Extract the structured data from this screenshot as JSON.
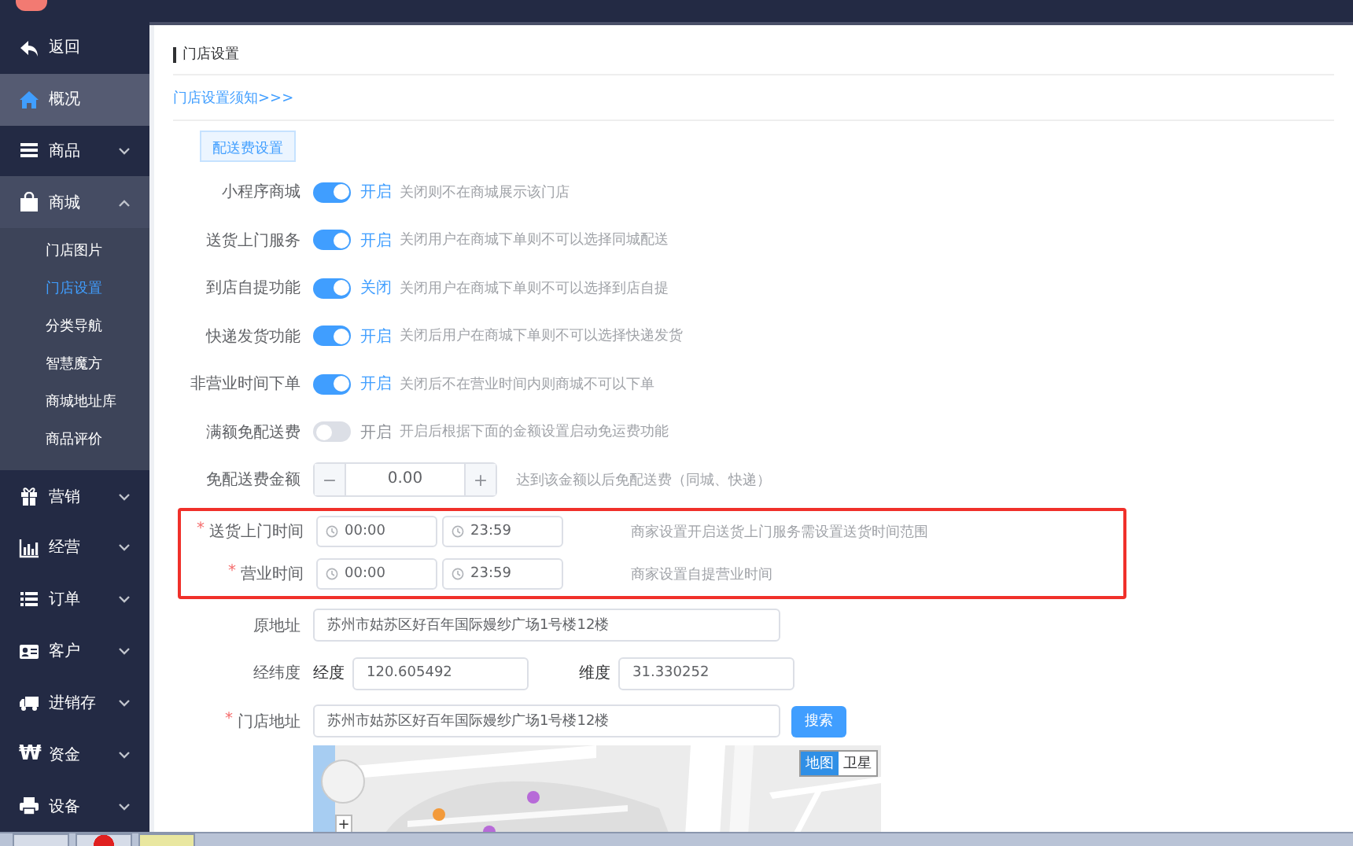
{
  "sidebar": {
    "items": [
      {
        "label": "返回",
        "kind": "link",
        "selected": false
      },
      {
        "label": "概况",
        "kind": "link",
        "selected": true
      },
      {
        "label": "商品",
        "kind": "group",
        "selected": false,
        "expanded": false
      },
      {
        "label": "商城",
        "kind": "group",
        "selected": false,
        "expanded": true,
        "children": [
          {
            "label": "门店图片",
            "selected": false
          },
          {
            "label": "门店设置",
            "selected": true
          },
          {
            "label": "分类导航",
            "selected": false
          },
          {
            "label": "智慧魔方",
            "selected": false
          },
          {
            "label": "商城地址库",
            "selected": false
          },
          {
            "label": "商品评价",
            "selected": false
          }
        ]
      },
      {
        "label": "营销",
        "kind": "group",
        "selected": false,
        "expanded": false
      },
      {
        "label": "经营",
        "kind": "group",
        "selected": false,
        "expanded": false
      },
      {
        "label": "订单",
        "kind": "group",
        "selected": false,
        "expanded": false
      },
      {
        "label": "客户",
        "kind": "group",
        "selected": false,
        "expanded": false
      },
      {
        "label": "进销存",
        "kind": "group",
        "selected": false,
        "expanded": false
      },
      {
        "label": "资金",
        "kind": "group",
        "selected": false,
        "expanded": false,
        "icon_text": "₩"
      },
      {
        "label": "设备",
        "kind": "group",
        "selected": false,
        "expanded": false
      }
    ]
  },
  "page": {
    "title": "门店设置",
    "notice_link": "门店设置须知>>>",
    "section_button": "配送费设置"
  },
  "switches": [
    {
      "label": "小程序商城",
      "on": true,
      "state_text": "开启",
      "hint": "关闭则不在商城展示该门店"
    },
    {
      "label": "送货上门服务",
      "on": true,
      "state_text": "开启",
      "hint": "关闭用户在商城下单则不可以选择同城配送"
    },
    {
      "label": "到店自提功能",
      "on": true,
      "state_text": "关闭",
      "hint": "关闭用户在商城下单则不可以选择到店自提"
    },
    {
      "label": "快递发货功能",
      "on": true,
      "state_text": "开启",
      "hint": "关闭后用户在商城下单则不可以选择快递发货"
    },
    {
      "label": "非营业时间下单",
      "on": true,
      "state_text": "开启",
      "hint": "关闭后不在营业时间内则商城不可以下单"
    },
    {
      "label": "满额免配送费",
      "on": false,
      "state_text": "开启",
      "hint": "开启后根据下面的金额设置启动免运费功能"
    }
  ],
  "free_amount": {
    "label": "免配送费金额",
    "minus": "−",
    "value": "0.00",
    "plus": "+",
    "hint": "达到该金额以后免配送费（同城、快递）"
  },
  "time_rows": [
    {
      "required_mark": "*",
      "label": "送货上门时间",
      "start": "00:00",
      "end": "23:59",
      "hint": "商家设置开启送货上门服务需设置送货时间范围"
    },
    {
      "required_mark": "*",
      "label": "营业时间",
      "start": "00:00",
      "end": "23:59",
      "hint": "商家设置自提营业时间"
    }
  ],
  "original_address": {
    "label": "原地址",
    "value": "苏州市姑苏区好百年国际嫚纱广场1号楼12楼"
  },
  "coordinates": {
    "label": "经纬度",
    "lng_label": "经度",
    "lng_value": "120.605492",
    "lat_label": "维度",
    "lat_value": "31.330252"
  },
  "store_address": {
    "required_mark": "*",
    "label": "门店地址",
    "value": "苏州市姑苏区好百年国际嫚纱广场1号楼12楼",
    "button": "搜索"
  },
  "map": {
    "kind": "picture",
    "zoom_in": "+",
    "types": [
      {
        "label": "地图",
        "selected": true
      },
      {
        "label": "卫星",
        "selected": false
      }
    ]
  }
}
